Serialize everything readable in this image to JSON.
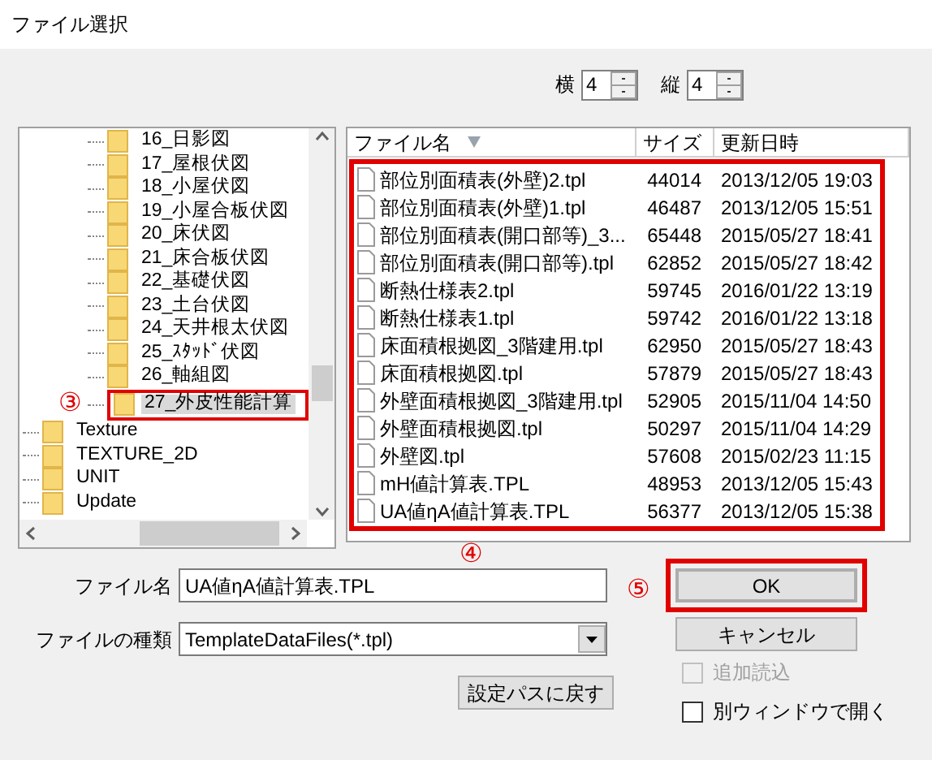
{
  "window": {
    "title": "ファイル選択"
  },
  "grid": [
    {
      "label": "横",
      "value": "4"
    },
    {
      "label": "縦",
      "value": "4"
    }
  ],
  "tree": {
    "items": [
      {
        "children": [
          {
            "label": "16_日影図",
            "selected": false
          },
          {
            "label": "17_屋根伏図",
            "selected": false
          },
          {
            "label": "18_小屋伏図",
            "selected": false
          },
          {
            "label": "19_小屋合板伏図",
            "selected": false
          },
          {
            "label": "20_床伏図",
            "selected": false
          },
          {
            "label": "21_床合板伏図",
            "selected": false
          },
          {
            "label": "22_基礎伏図",
            "selected": false
          },
          {
            "label": "23_土台伏図",
            "selected": false
          },
          {
            "label": "24_天井根太伏図",
            "selected": false
          },
          {
            "label": "25_ｽﾀｯﾄﾞ伏図",
            "selected": false
          },
          {
            "label": "26_軸組図",
            "selected": false
          },
          {
            "label": "27_外皮性能計算",
            "selected": true,
            "annotation": "③"
          }
        ]
      },
      {
        "label": "Texture",
        "selected": false
      },
      {
        "label": "TEXTURE_2D",
        "selected": false
      },
      {
        "label": "UNIT",
        "selected": false
      },
      {
        "label": "Update",
        "selected": false
      }
    ]
  },
  "file_list": {
    "columns": [
      "ファイル名",
      "サイズ",
      "更新日時"
    ],
    "annotation": "④",
    "rows": [
      {
        "name": "部位別面積表(外壁)2.tpl",
        "size": "44014",
        "modified": "2013/12/05 19:03"
      },
      {
        "name": "部位別面積表(外壁)1.tpl",
        "size": "46487",
        "modified": "2013/12/05 15:51"
      },
      {
        "name": "部位別面積表(開口部等)_3...",
        "size": "65448",
        "modified": "2015/05/27 18:41"
      },
      {
        "name": "部位別面積表(開口部等).tpl",
        "size": "62852",
        "modified": "2015/05/27 18:42"
      },
      {
        "name": "断熱仕様表2.tpl",
        "size": "59745",
        "modified": "2016/01/22 13:19"
      },
      {
        "name": "断熱仕様表1.tpl",
        "size": "59742",
        "modified": "2016/01/22 13:18"
      },
      {
        "name": "床面積根拠図_3階建用.tpl",
        "size": "62950",
        "modified": "2015/05/27 18:43"
      },
      {
        "name": "床面積根拠図.tpl",
        "size": "57879",
        "modified": "2015/05/27 18:43"
      },
      {
        "name": "外壁面積根拠図_3階建用.tpl",
        "size": "52905",
        "modified": "2015/11/04 14:50"
      },
      {
        "name": "外壁面積根拠図.tpl",
        "size": "50297",
        "modified": "2015/11/04 14:29"
      },
      {
        "name": "外壁図.tpl",
        "size": "57608",
        "modified": "2015/02/23 11:15"
      },
      {
        "name": "mH値計算表.TPL",
        "size": "48953",
        "modified": "2013/12/05 15:43"
      },
      {
        "name": "UA値ηA値計算表.TPL",
        "size": "56377",
        "modified": "2013/12/05 15:38"
      }
    ]
  },
  "file_name": {
    "label": "ファイル名",
    "value": "UA値ηA値計算表.TPL"
  },
  "file_type": {
    "label": "ファイルの種類",
    "value": "TemplateDataFiles(*.tpl)"
  },
  "reset_path_button": "設定パスに戻す",
  "ok_button": {
    "label": "OK",
    "annotation": "⑤"
  },
  "cancel_button": "キャンセル",
  "options": [
    {
      "label": "追加読込",
      "checked": false,
      "disabled": true
    },
    {
      "label": "別ウィンドウで開く",
      "checked": false,
      "disabled": false
    }
  ]
}
